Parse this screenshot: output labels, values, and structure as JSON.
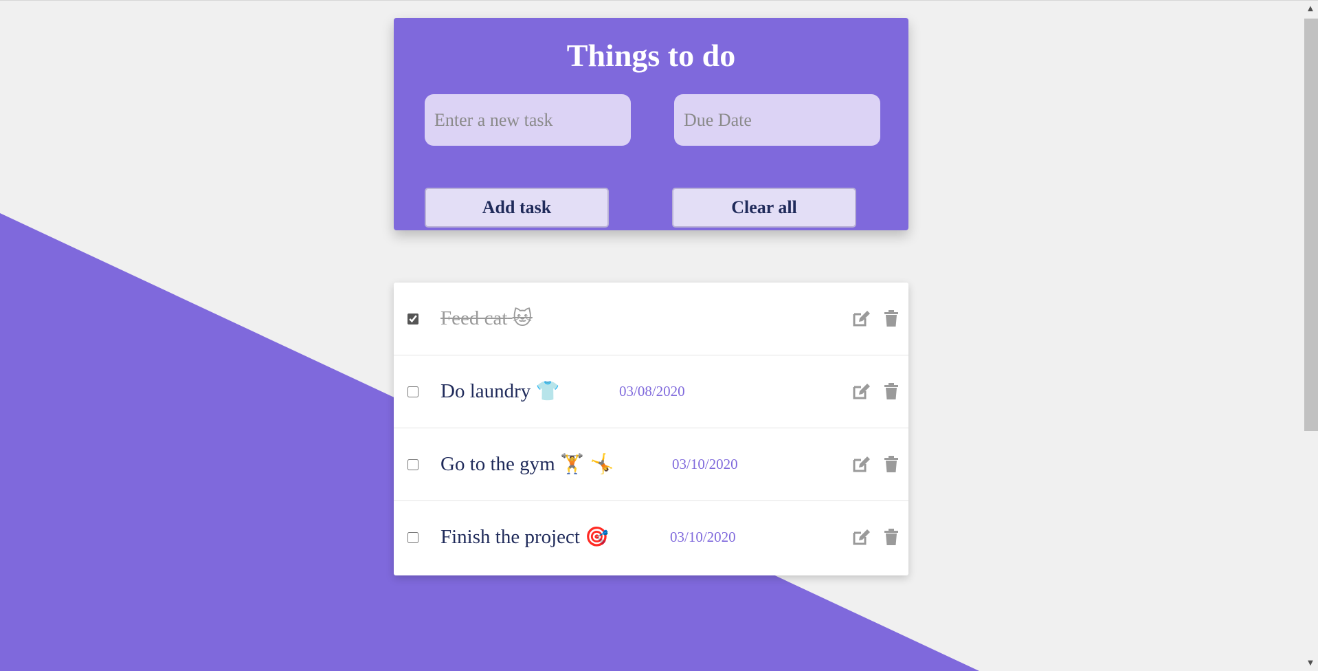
{
  "header": {
    "title": "Things to do",
    "task_placeholder": "Enter a new task",
    "date_placeholder": "Due Date",
    "add_label": "Add task",
    "clear_label": "Clear all"
  },
  "tasks": [
    {
      "text": "Feed cat",
      "emoji": "🐱",
      "date": "",
      "done": true
    },
    {
      "text": "Do laundry",
      "emoji": "👕",
      "date": "03/08/2020",
      "done": false
    },
    {
      "text": "Go to the gym",
      "emoji": "🏋 🤸",
      "date": "03/10/2020",
      "done": false
    },
    {
      "text": "Finish the project",
      "emoji": "🎯",
      "date": "03/10/2020",
      "done": false
    }
  ],
  "colors": {
    "accent": "#7f69dc",
    "background": "#f0f0f0",
    "task_text": "#1f2a5a",
    "icon_gray": "#9a9a9a"
  },
  "icons": [
    "edit-icon",
    "trash-icon",
    "scroll-up-icon",
    "scroll-down-icon"
  ]
}
